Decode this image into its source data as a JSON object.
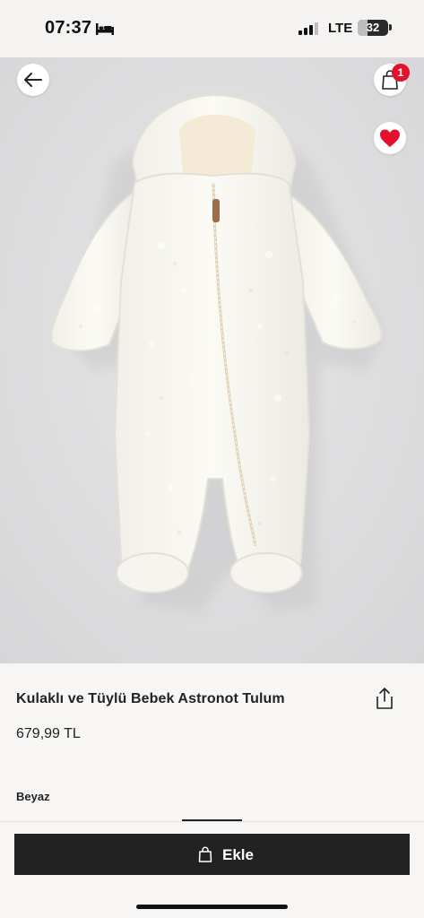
{
  "status_bar": {
    "time": "07:37",
    "sleep_icon": "bed-icon",
    "signal_icon": "cellular-signal-icon",
    "network": "LTE",
    "battery_level": "32",
    "battery_fraction": 0.32
  },
  "header": {
    "back_icon": "arrow-left-icon",
    "cart_icon": "shopping-bag-icon",
    "cart_count": "1",
    "favorite_icon": "heart-filled-icon"
  },
  "gallery": {
    "image_count": 3,
    "active_index": 1
  },
  "product": {
    "title": "Kulaklı ve Tüylü Bebek Astronot Tulum",
    "price": "679,99 TL",
    "share_icon": "share-icon",
    "color": "Beyaz"
  },
  "actions": {
    "add_label": "Ekle",
    "add_icon": "shopping-bag-icon"
  },
  "colors": {
    "accent_red": "#e3112b",
    "button_dark": "#222222"
  }
}
